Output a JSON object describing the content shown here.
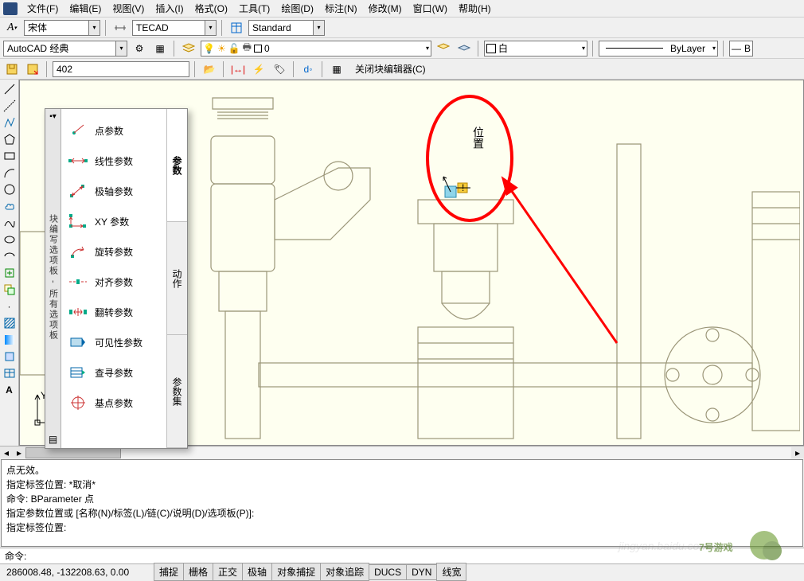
{
  "menubar": {
    "items": [
      "文件(F)",
      "编辑(E)",
      "视图(V)",
      "插入(I)",
      "格式(O)",
      "工具(T)",
      "绘图(D)",
      "标注(N)",
      "修改(M)",
      "窗口(W)",
      "帮助(H)"
    ]
  },
  "toolbar1": {
    "font": "宋体",
    "style": "TECAD",
    "dimstyle": "Standard"
  },
  "toolbar2": {
    "workspace": "AutoCAD 经典",
    "layer": "0",
    "color_label": "白",
    "linetype": "ByLayer"
  },
  "block_editor_bar": {
    "input": "402",
    "close_label": "关闭块编辑器(C)"
  },
  "palette": {
    "title": "块编写选项板 - 所有选项板",
    "tabs": [
      "参数",
      "动作",
      "参数集"
    ],
    "active_tab": 0,
    "items": [
      {
        "label": "点参数",
        "icon": "point"
      },
      {
        "label": "线性参数",
        "icon": "linear"
      },
      {
        "label": "极轴参数",
        "icon": "polar"
      },
      {
        "label": "XY 参数",
        "icon": "xy"
      },
      {
        "label": "旋转参数",
        "icon": "rotate"
      },
      {
        "label": "对齐参数",
        "icon": "align"
      },
      {
        "label": "翻转参数",
        "icon": "flip"
      },
      {
        "label": "可见性参数",
        "icon": "visibility"
      },
      {
        "label": "查寻参数",
        "icon": "lookup"
      },
      {
        "label": "基点参数",
        "icon": "basepoint"
      }
    ]
  },
  "annotation": {
    "label": "位置"
  },
  "command_window": {
    "lines": [
      "点无效。",
      "指定标签位置:  *取消*",
      "命令: BParameter 点",
      "指定参数位置或 [名称(N)/标签(L)/链(C)/说明(D)/选项板(P)]:",
      "指定标签位置:"
    ],
    "prompt_label": "命令:",
    "prompt_value": ""
  },
  "statusbar": {
    "coords": "286008.48, -132208.63, 0.00",
    "buttons": [
      "捕捉",
      "栅格",
      "正交",
      "极轴",
      "对象捕捉",
      "对象追踪",
      "DUCS",
      "DYN",
      "线宽"
    ]
  },
  "watermarks": {
    "site": "7号游戏",
    "baidu": "jingyan.baidu.com"
  }
}
